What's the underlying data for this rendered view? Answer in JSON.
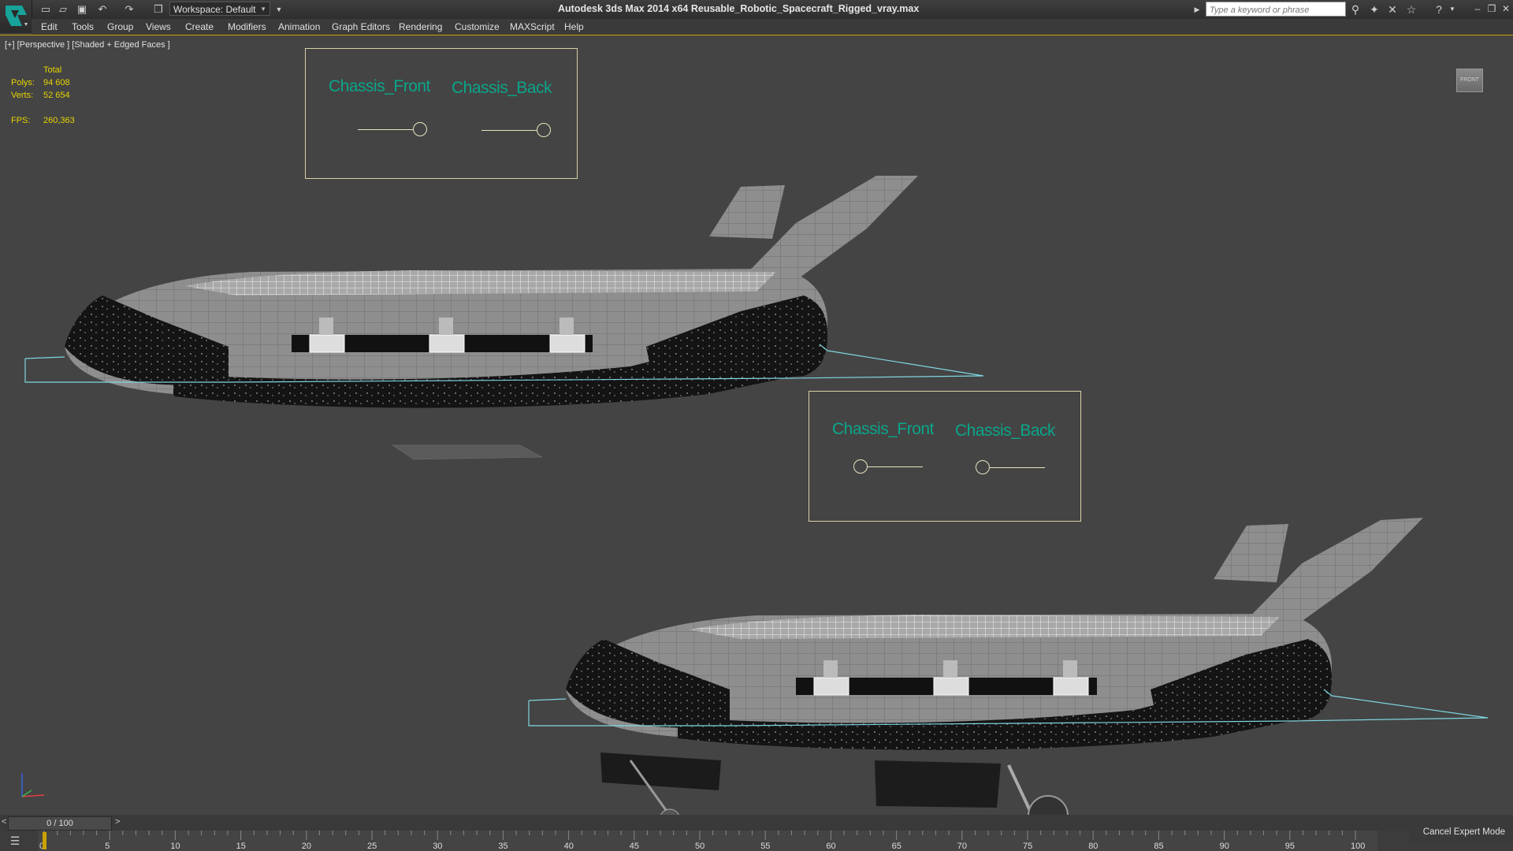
{
  "titlebar": {
    "workspace_label": "Workspace: Default",
    "app_title": "Autodesk 3ds Max  2014 x64     Reusable_Robotic_Spacecraft_Rigged_vray.max",
    "search_placeholder": "Type a keyword or phrase"
  },
  "menu": [
    "Edit",
    "Tools",
    "Group",
    "Views",
    "Create",
    "Modifiers",
    "Animation",
    "Graph Editors",
    "Rendering",
    "Customize",
    "MAXScript",
    "Help"
  ],
  "viewport": {
    "label": "[+] [Perspective ] [Shaded + Edged Faces ]",
    "viewcube_label": "FRONT",
    "stats": {
      "total_label": "Total",
      "polys_label": "Polys:",
      "polys_value": "94 608",
      "verts_label": "Verts:",
      "verts_value": "52 654",
      "fps_label": "FPS:",
      "fps_value": "260,363"
    },
    "control_panels": [
      {
        "front_label": "Chassis_Front",
        "back_label": "Chassis_Back"
      },
      {
        "front_label": "Chassis_Front",
        "back_label": "Chassis_Back"
      }
    ]
  },
  "timeline": {
    "slider_label": "0 / 100",
    "prev": "<",
    "next": ">",
    "ticks": [
      "0",
      "5",
      "10",
      "15",
      "20",
      "25",
      "30",
      "35",
      "40",
      "45",
      "50",
      "55",
      "60",
      "65",
      "70",
      "75",
      "80",
      "85",
      "90",
      "95",
      "100"
    ]
  },
  "status": {
    "cancel_expert": "Cancel Expert Mode"
  },
  "colors": {
    "viewport_bg": "#444444",
    "stats_yellow": "#e5d400",
    "control_text": "#0aa68a",
    "selection_cyan": "#7fd6e0"
  }
}
